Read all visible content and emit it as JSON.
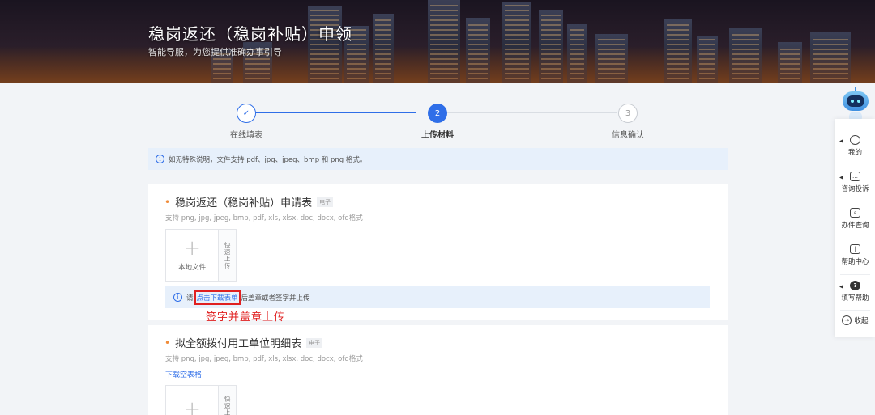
{
  "header": {
    "title": "稳岗返还（稳岗补贴）申领",
    "subtitle": "智能导服，为您提供准确办事引导"
  },
  "steps": [
    {
      "label": "在线填表",
      "status": "done",
      "icon": "check-icon"
    },
    {
      "label": "上传材料",
      "status": "active",
      "number": "2"
    },
    {
      "label": "信息确认",
      "status": "pending",
      "number": "3"
    }
  ],
  "notice": {
    "text": "如无特殊说明，文件支持 pdf、jpg、jpeg、bmp 和 png 格式。"
  },
  "materials": [
    {
      "title": "稳岗返还（稳岗补贴）申请表",
      "tag": "电子",
      "formats": "支持 png, jpg, jpeg, bmp, pdf, xls, xlsx, doc, docx, ofd格式",
      "upload_label": "本地文件",
      "quick_upload": "快速上传",
      "tip_prefix": "请",
      "tip_link": "点击下载表单",
      "tip_suffix": "后盖章或者签字并上传",
      "annotation": "签字并盖章上传"
    },
    {
      "title": "拟全额拨付用工单位明细表",
      "tag": "电子",
      "formats": "支持 png, jpg, jpeg, bmp, pdf, xls, xlsx, doc, docx, ofd格式",
      "download_link": "下载空表格",
      "quick_upload": "快速上传"
    }
  ],
  "sidebar": {
    "items": [
      {
        "label": "我的",
        "icon": "bulb-icon"
      },
      {
        "label": "咨询投诉",
        "icon": "chat-icon"
      },
      {
        "label": "办件查询",
        "icon": "search-doc-icon"
      },
      {
        "label": "帮助中心",
        "icon": "book-icon"
      },
      {
        "label": "填写帮助",
        "icon": "question-icon"
      }
    ],
    "collapse": "收起"
  },
  "colors": {
    "primary": "#2f6ee8",
    "annotation": "#e02020",
    "required_dot": "#f08c3a"
  }
}
